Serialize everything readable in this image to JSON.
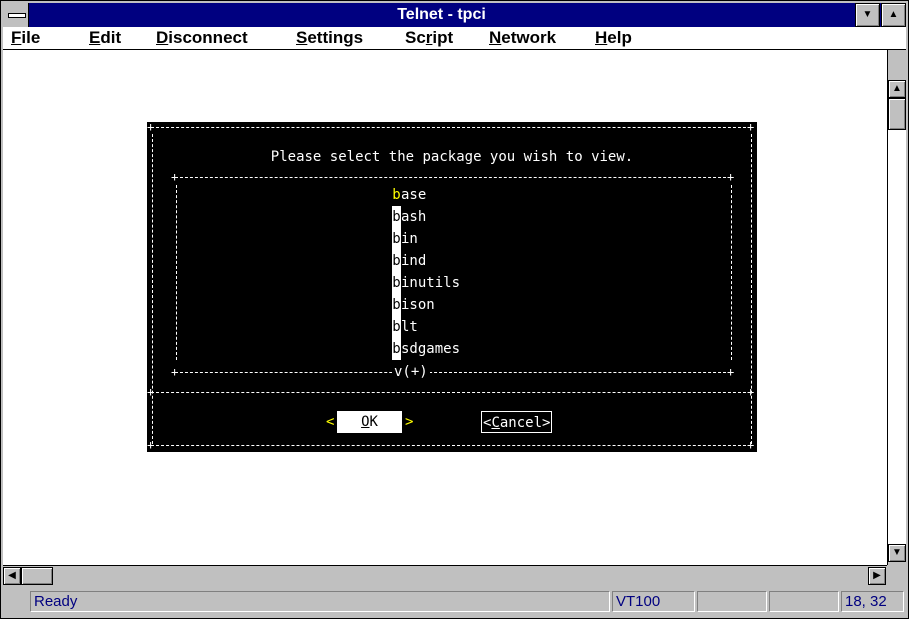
{
  "window": {
    "title": "Telnet - tpci",
    "minimize_glyph": "▼",
    "maximize_glyph": "▲"
  },
  "menu": [
    {
      "label": "File",
      "mnemonic": "F",
      "rest": "ile"
    },
    {
      "label": "Edit",
      "mnemonic": "E",
      "rest": "dit"
    },
    {
      "label": "Disconnect",
      "mnemonic": "D",
      "rest": "isconnect"
    },
    {
      "label": "Settings",
      "mnemonic": "S",
      "rest": "ettings"
    },
    {
      "label": "Script",
      "pre": "Sc",
      "mnemonic": "r",
      "rest": "ipt"
    },
    {
      "label": "Network",
      "mnemonic": "N",
      "rest": "etwork"
    },
    {
      "label": "Help",
      "mnemonic": "H",
      "rest": "elp"
    }
  ],
  "terminal": {
    "prompt": "Please select the package you wish to view.",
    "packages": [
      {
        "first": "b",
        "rest": "ase",
        "selected": true
      },
      {
        "first": "b",
        "rest": "ash",
        "selected": false
      },
      {
        "first": "b",
        "rest": "in",
        "selected": false
      },
      {
        "first": "b",
        "rest": "ind",
        "selected": false
      },
      {
        "first": "b",
        "rest": "inutils",
        "selected": false
      },
      {
        "first": "b",
        "rest": "ison",
        "selected": false
      },
      {
        "first": "b",
        "rest": "lt",
        "selected": false
      },
      {
        "first": "b",
        "rest": "sdgames",
        "selected": false
      }
    ],
    "more_indicator": "v(+)",
    "ok_left_bracket": "<",
    "ok_label": "OK",
    "ok_mnemonic": "O",
    "ok_rest": "K",
    "ok_right_bracket": ">",
    "cancel_open": "<",
    "cancel_mnemonic": "C",
    "cancel_rest": "ancel",
    "cancel_close": ">"
  },
  "statusbar": {
    "status": "Ready",
    "emulation": "VT100",
    "position": "18, 32"
  },
  "colors": {
    "titlebar": "#000080",
    "terminal_bg": "#000000",
    "highlight": "#ffff00",
    "status_text": "#000080"
  }
}
